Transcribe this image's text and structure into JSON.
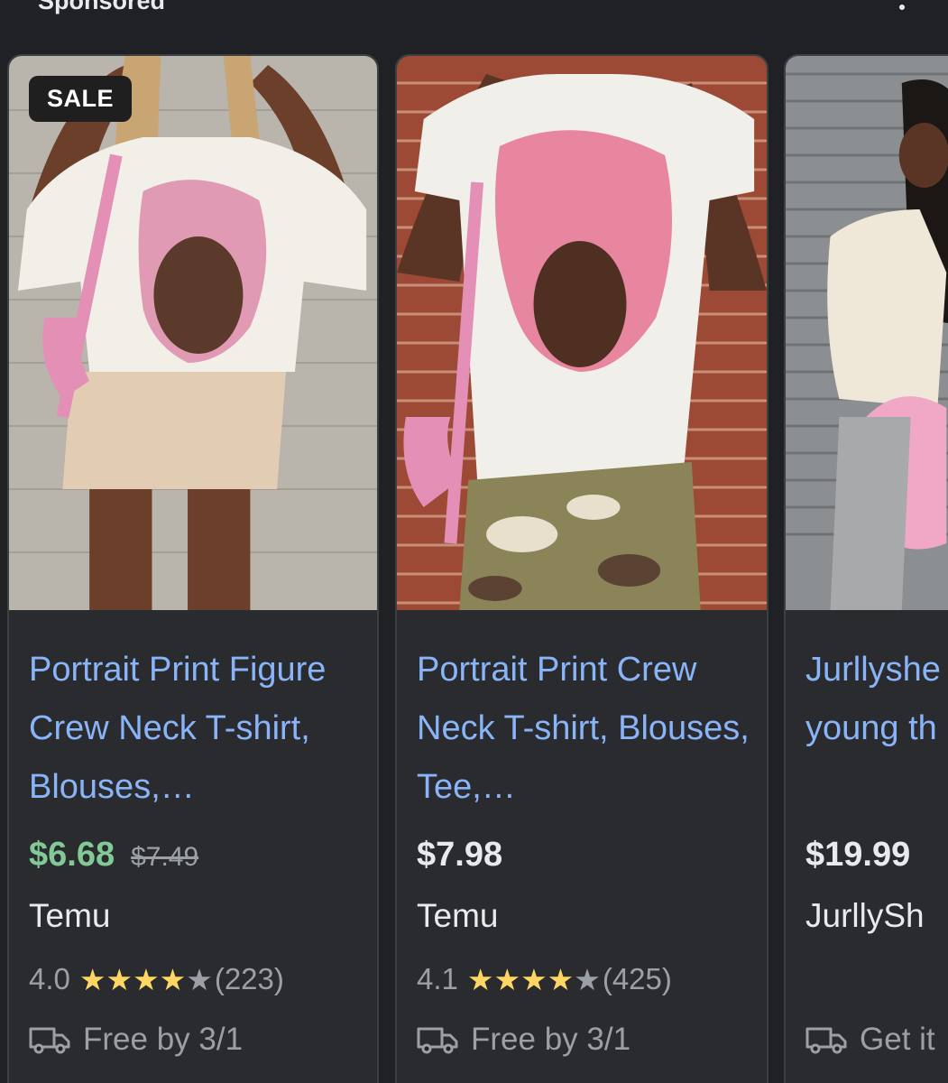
{
  "header": {
    "label": "Sponsored",
    "more_icon": "more-vert-icon"
  },
  "products": [
    {
      "badge": "SALE",
      "title": "Portrait Print Figure Crew Neck T-shirt, Blouses,…",
      "price": "$6.68",
      "old_price": "$7.49",
      "merchant": "Temu",
      "rating": "4.0",
      "stars": 4,
      "reviews": "(223)",
      "shipping": "Free by 3/1"
    },
    {
      "title": "Portrait Print Crew Neck T-shirt, Blouses, Tee,…",
      "price": "$7.98",
      "merchant": "Temu",
      "rating": "4.1",
      "stars": 4,
      "reviews": "(425)",
      "shipping": "Free by 3/1"
    },
    {
      "title": "Jurllyshe young th",
      "price": "$19.99",
      "merchant": "JurllySh",
      "shipping": "Get it"
    }
  ],
  "colors": {
    "background": "#202124",
    "card": "#2a2b2e",
    "title_link": "#8ab4f8",
    "sale_price": "#81c995",
    "star": "#fdd663",
    "muted": "#9aa0a6"
  },
  "icons": {
    "shipping": "truck-icon",
    "star": "star-icon"
  }
}
